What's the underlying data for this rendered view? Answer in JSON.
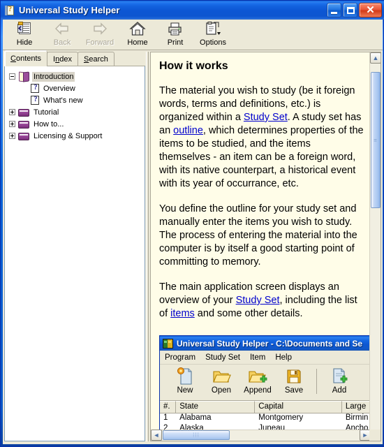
{
  "window": {
    "title": "Universal Study Helper",
    "icon": "help-book-icon",
    "buttons": {
      "minimize": "Minimize",
      "maximize": "Maximize",
      "close": "Close"
    }
  },
  "toolbar": {
    "items": [
      {
        "label": "Hide",
        "icon": "hide-panel-icon",
        "disabled": false
      },
      {
        "label": "Back",
        "icon": "back-arrow-icon",
        "disabled": true
      },
      {
        "label": "Forward",
        "icon": "forward-arrow-icon",
        "disabled": true
      },
      {
        "label": "Home",
        "icon": "home-icon",
        "disabled": false
      },
      {
        "label": "Print",
        "icon": "printer-icon",
        "disabled": false
      },
      {
        "label": "Options",
        "icon": "options-icon",
        "disabled": false
      }
    ]
  },
  "left_panel": {
    "tabs": [
      {
        "label": "Contents",
        "accel": "C",
        "active": true
      },
      {
        "label": "Index",
        "accel": "n",
        "active": false
      },
      {
        "label": "Search",
        "accel": "S",
        "active": false
      }
    ],
    "tree": [
      {
        "label": "Introduction",
        "icon": "open-book-icon",
        "expander": "minus",
        "depth": 0,
        "selected": true
      },
      {
        "label": "Overview",
        "icon": "help-page-icon",
        "expander": "none",
        "depth": 1,
        "selected": false
      },
      {
        "label": "What's new",
        "icon": "help-page-icon",
        "expander": "none",
        "depth": 1,
        "selected": false
      },
      {
        "label": "Tutorial",
        "icon": "closed-book-icon",
        "expander": "plus",
        "depth": 0,
        "selected": false
      },
      {
        "label": "How to...",
        "icon": "closed-book-icon",
        "expander": "plus",
        "depth": 0,
        "selected": false
      },
      {
        "label": "Licensing & Support",
        "icon": "closed-book-icon",
        "expander": "plus",
        "depth": 0,
        "selected": false
      }
    ]
  },
  "content": {
    "heading": "How it works",
    "para1_a": "The material you wish to study (be it foreign words, terms and definitions, etc.) is organized within a ",
    "link_study_set_1": "Study Set",
    "para1_b": ". A study set has an ",
    "link_outline": "outline",
    "para1_c": ", which determines properties of the items to be studied, and the items themselves - an item can be a foreign word, with its native counterpart, a historical event with its year of occurrance, etc.",
    "para2": "You define the outline for your study set and manually enter the items you wish to study. The process of entering the material into the computer is by itself a good starting point of committing to memory.",
    "para3_a": "The main application screen displays an overview of your ",
    "link_study_set_2": "Study Set",
    "para3_b": ", including the list of ",
    "link_items": "items",
    "para3_c": " and some other details."
  },
  "screenshot": {
    "title": "Universal Study Helper  -  C:\\Documents and Se",
    "icon": "app-globe-icon",
    "menu": [
      "Program",
      "Study Set",
      "Item",
      "Help"
    ],
    "toolbar": [
      {
        "label": "New",
        "icon": "new-document-icon"
      },
      {
        "label": "Open",
        "icon": "open-folder-icon"
      },
      {
        "label": "Append",
        "icon": "append-folder-icon"
      },
      {
        "label": "Save",
        "icon": "floppy-save-icon"
      },
      {
        "label": "Add",
        "icon": "add-document-icon"
      }
    ],
    "table": {
      "columns": [
        "#.",
        "State",
        "Capital",
        "Large"
      ],
      "rows": [
        [
          "1",
          "Alabama",
          "Montgomery",
          "Birmin"
        ],
        [
          "2",
          "Alaska",
          "Juneau",
          "Ancho"
        ]
      ]
    }
  },
  "scrollbars": {
    "content_vertical": {
      "up": "▲",
      "down": "▼",
      "grip": "≡"
    },
    "content_horizontal": {
      "left": "◄",
      "right": "►",
      "grip": "⁞⁞"
    }
  },
  "colors": {
    "titlebar_blue": "#0d57d4",
    "window_frame": "#0831ab",
    "face": "#ece9d8",
    "content_bg": "#fffde8",
    "link": "#0000cc",
    "selection": "#d8d4c8"
  }
}
